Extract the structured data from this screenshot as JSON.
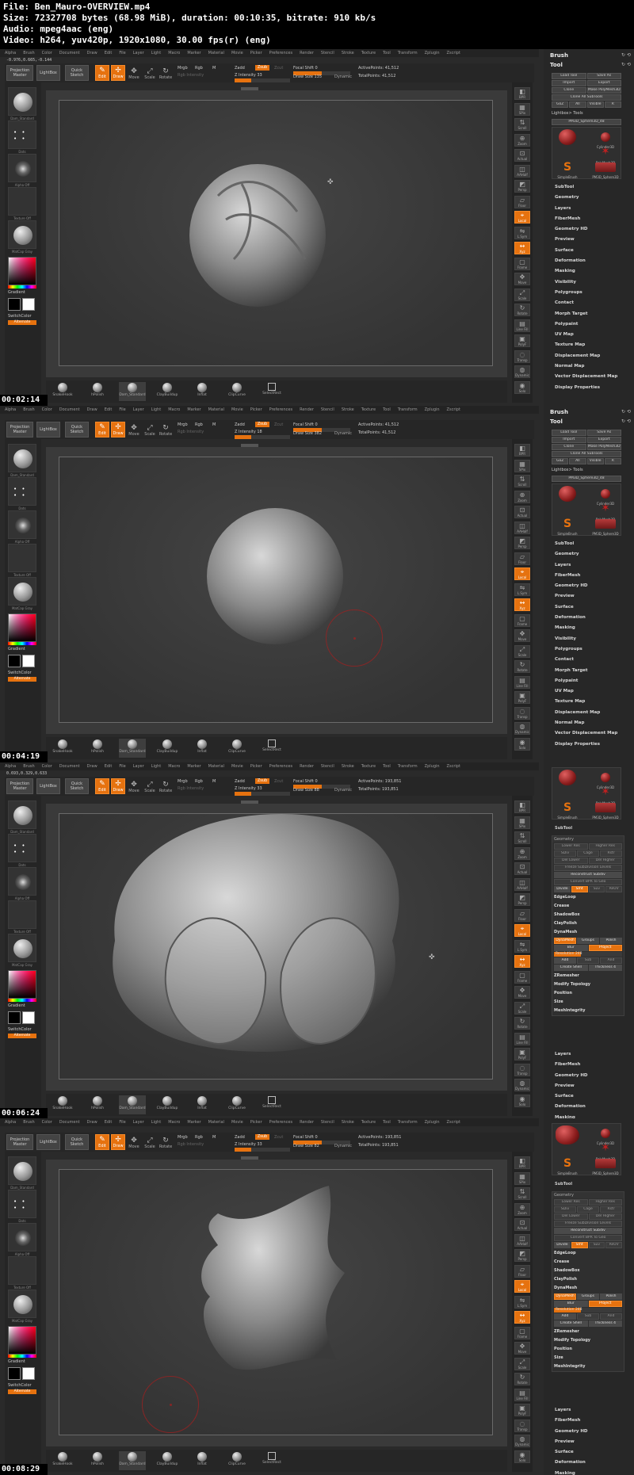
{
  "header": {
    "file": "File: Ben_Mauro-OVERVIEW.mp4",
    "size": "Size: 72327708 bytes (68.98 MiB), duration: 00:10:35, bitrate: 910 kb/s",
    "audio": "Audio: mpeg4aac (eng)",
    "video": "Video: h264, yuv420p, 1920x1080, 30.00 fps(r) (eng)"
  },
  "colors": {
    "accent": "#e6720f",
    "bg": "#2a2a2a",
    "brush_ring": "#a02020"
  },
  "menu": [
    "Alpha",
    "Brush",
    "Color",
    "Document",
    "Draw",
    "Edit",
    "File",
    "Layer",
    "Light",
    "Macro",
    "Marker",
    "Material",
    "Movie",
    "Picker",
    "Preferences",
    "Render",
    "Stencil",
    "Stroke",
    "Texture",
    "Tool",
    "Transform",
    "Zplugin",
    "Zscript"
  ],
  "toolbar": {
    "projection_master": "Projection Master",
    "lightbox": "LightBox",
    "quick_sketch": "Quick Sketch",
    "edit": "Edit",
    "draw": "Draw",
    "move": "Move",
    "scale": "Scale",
    "rotate": "Rotate",
    "mrgb": "Mrgb",
    "rgb": "Rgb",
    "m": "M",
    "rgb_intensity": "Rgb Intensity",
    "zadd": "Zadd",
    "zsub": "Zsub",
    "zcut": "Zcut",
    "focal_shift_label": "Focal Shift",
    "draw_size_label": "Draw Size",
    "dynamic": "Dynamic",
    "active_points_label": "ActivePoints:",
    "total_points_label": "TotalPoints:"
  },
  "leftshelf": {
    "brush_label": "Dam_Standard",
    "stroke_label": "Dots",
    "alpha_label": "Alpha Off",
    "texture_label": "Texture Off",
    "material_label": "MatCap Gray",
    "gradient": "Gradient",
    "switch_color": "SwitchColor",
    "alternate": "Alternate"
  },
  "bottomshelf": [
    "SnakeHook",
    "hPolish",
    "Dam_Standard",
    "ClayBuildup",
    "Inflat",
    "ClipCurve",
    "SelectRect"
  ],
  "rightshelf": [
    "BPR",
    "SPix",
    "Scroll",
    "Zoom",
    "Actual",
    "AAHalf",
    "Persp",
    "Floor",
    "Local",
    "L.Sym",
    "Xyz",
    "Frame",
    "Move",
    "Scale",
    "Rotate",
    "Line Fill",
    "PolyF",
    "Transp",
    "Dynamic",
    "Solo"
  ],
  "rpanel": {
    "brush": "Brush",
    "tool": "Tool",
    "load_tool": "Load Tool",
    "save_as": "Save As",
    "import": "Import",
    "export": "Export",
    "clone": "Clone",
    "make_polymesh": "Make PolyMesh3D",
    "clone_all_subtools": "Clone All SubTools",
    "goz": "GoZ",
    "all": "All",
    "visible": "Visible",
    "r": "R",
    "lightbox_tools": "Lightbox> Tools",
    "pm3d_sphere": "PM3D_Sphere3D_48",
    "cylinder": "Cylinder3D",
    "polymesh": "PolyMesh3D",
    "simplebrush": "SimpleBrush",
    "pm3d_short": "PM3D_Sphere3D",
    "list": [
      "SubTool",
      "Geometry",
      "Layers",
      "FiberMesh",
      "Geometry HD",
      "Preview",
      "Surface",
      "Deformation",
      "Masking",
      "Visibility",
      "Polygroups",
      "Contact",
      "Morph Target",
      "Polypaint",
      "UV Map",
      "Texture Map",
      "Displacement Map",
      "Normal Map",
      "Vector Displacement Map",
      "Display Properties"
    ],
    "list_short": [
      "Layers",
      "FiberMesh",
      "Geometry HD",
      "Preview",
      "Surface",
      "Deformation",
      "Masking"
    ],
    "geometry": {
      "title": "Geometry",
      "lower_res": "Lower Res",
      "higher_res": "Higher Res",
      "sdiv": "SDiv",
      "cage": "Cage",
      "rstr": "Rstr",
      "del_lower": "Del Lower",
      "del_higher": "Del Higher",
      "freeze_subdiv": "Freeze SubDivision Levels",
      "reconstruct_subdiv": "Reconstruct Subdiv",
      "convert_bpr": "Convert BPR To Geo",
      "divide": "Divide",
      "smt": "Smt",
      "suv": "Suv",
      "reuv": "ReUV",
      "edgeloop": "EdgeLoop",
      "crease": "Crease",
      "shadowbox": "ShadowBox",
      "claypolish": "ClayPolish",
      "dynamesh_title": "DynaMesh",
      "dynamesh_btn": "DynaMesh",
      "groups": "Groups",
      "polish": "Polish",
      "blur": "Blur",
      "project": "Project",
      "resolution": "Resolution 248",
      "add": "Add",
      "sub": "Sub",
      "and": "And",
      "create_shell": "Create Shell",
      "thickness": "Thickness 4",
      "zremesher": "ZRemesher",
      "modify_topology": "Modify Topology",
      "position": "Position",
      "size": "Size",
      "meshintegrity": "MeshIntegrity"
    }
  },
  "frames": [
    {
      "timestamp": "00:02:14",
      "coords": "-0.976,0.665,-0.144",
      "z_intensity": "Z Intensity 33",
      "focal_shift": "Focal Shift 0",
      "draw_size": "Draw Size 135",
      "active_points": "ActivePoints: 41,512",
      "total_points": "TotalPoints: 41,512"
    },
    {
      "timestamp": "00:04:19",
      "coords": "",
      "z_intensity": "Z Intensity 18",
      "focal_shift": "Focal Shift 0",
      "draw_size": "Draw Size 382",
      "active_points": "ActivePoints: 41,512",
      "total_points": "TotalPoints: 41,512"
    },
    {
      "timestamp": "00:06:24",
      "coords": "0.693,0.329,0.633",
      "z_intensity": "Z Intensity 33",
      "focal_shift": "Focal Shift 0",
      "draw_size": "Draw Size 88",
      "active_points": "ActivePoints: 193,851",
      "total_points": "TotalPoints: 193,851"
    },
    {
      "timestamp": "00:08:29",
      "coords": "",
      "z_intensity": "Z Intensity 33",
      "focal_shift": "Focal Shift 0",
      "draw_size": "Draw Size 82",
      "active_points": "ActivePoints: 193,851",
      "total_points": "TotalPoints: 193,851"
    }
  ]
}
